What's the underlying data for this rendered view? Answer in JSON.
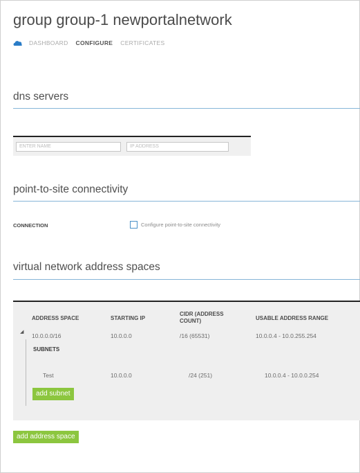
{
  "page": {
    "title": "group group-1 newportalnetwork"
  },
  "nav": {
    "tabs": [
      "DASHBOARD",
      "CONFIGURE",
      "CERTIFICATES"
    ],
    "active_tab": "CONFIGURE",
    "icon": "cloud-network-icon"
  },
  "dns": {
    "section_title": "dns servers",
    "name_placeholder": "ENTER NAME",
    "ip_placeholder": "IP ADDRESS"
  },
  "p2s": {
    "section_title": "point-to-site connectivity",
    "connection_label": "CONNECTION",
    "checkbox_label": "Configure point-to-site connectivity"
  },
  "vnet": {
    "section_title": "virtual network address spaces",
    "columns": [
      "ADDRESS SPACE",
      "STARTING IP",
      "CIDR (ADDRESS COUNT)",
      "USABLE ADDRESS RANGE"
    ],
    "address_space": {
      "address": "10.0.0.0/16",
      "starting_ip": "10.0.0.0",
      "cidr": "/16 (65531)",
      "range": "10.0.0.4 - 10.0.255.254"
    },
    "subnets_label": "SUBNETS",
    "subnet": {
      "name": "Test",
      "starting_ip": "10.0.0.0",
      "cidr": "/24 (251)",
      "range": "10.0.0.4 - 10.0.0.254"
    },
    "add_subnet_label": "add subnet",
    "add_address_space_label": "add address space"
  },
  "colors": {
    "accent_green": "#8cc63f",
    "rule_blue": "#86b5d8",
    "checkbox_border": "#4a90c8"
  }
}
